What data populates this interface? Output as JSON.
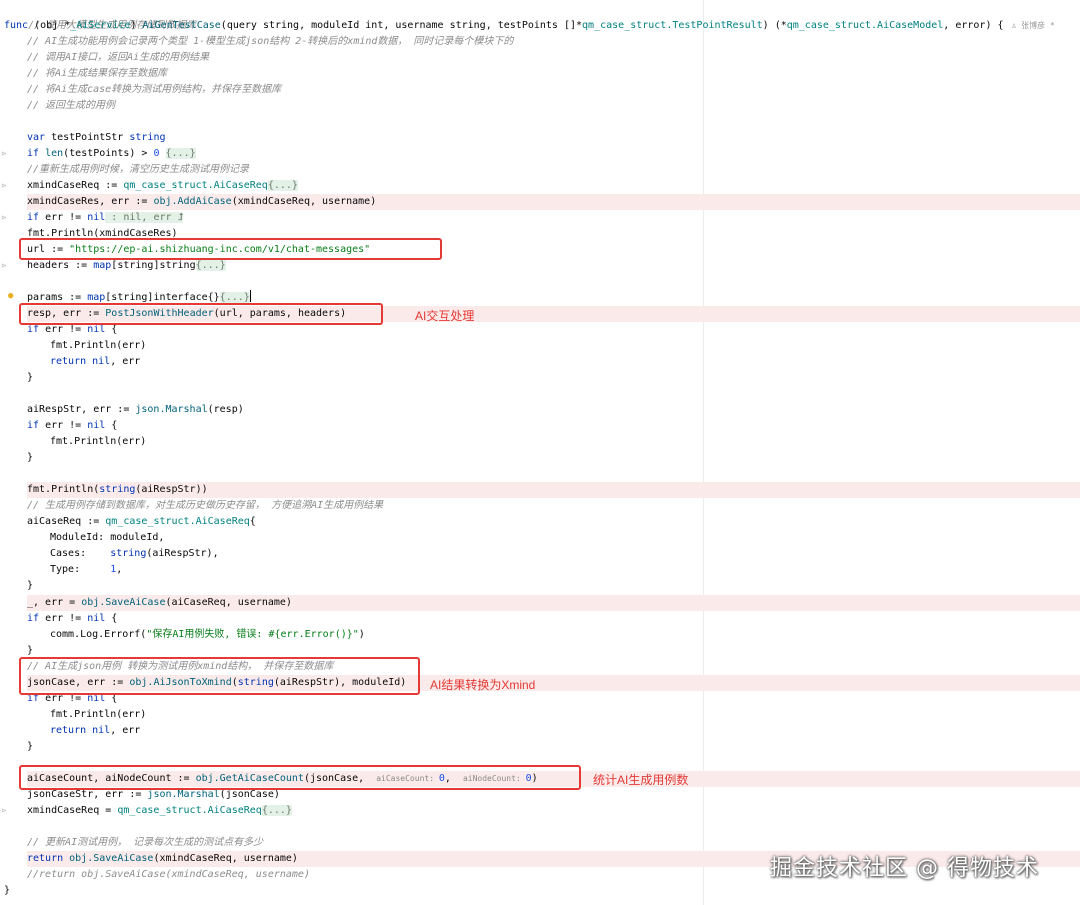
{
  "header_comment": "// 使用大模型生成用例存储到数据库",
  "func_sig": {
    "kw": "func",
    "recv_open": " (obj *",
    "recv_type": "_AiService",
    "recv_close": ") ",
    "name": "AiGenTestCase",
    "params_a": "(query string, moduleId int, username string, testPoints []*",
    "type1": "qm_case_struct.TestPointResult",
    "mid": ") (*",
    "type2": "qm_case_struct.AiCaseModel",
    "tail": ", error) {",
    "author": "♙ 张博彦 *"
  },
  "doc_comments": [
    "// AI生成功能用例会记录两个类型 1-模型生成json结构 2-转换后的xmind数据， 同时记录每个模块下的",
    "// 调用AI接口，返回Ai生成的用例结果",
    "// 将Ai生成结果保存至数据库",
    "// 将Ai生成case转换为测试用例结构，并保存至数据库",
    "// 返回生成的用例"
  ],
  "var_line": {
    "kw": "var",
    "rest": " testPointStr ",
    "type": "string"
  },
  "if_len": {
    "kw": "if",
    "fn": " len",
    "rest": "(testPoints) > ",
    "num": "0",
    "fold": "{...}"
  },
  "reset_comment": "//重新生成用例时候，清空历史生成测试用例记录",
  "xmind_req": {
    "lhs": "xmindCaseReq := ",
    "type": "qm_case_struct.AiCaseReq",
    "fold": "{...}"
  },
  "add_case": {
    "lhs": "xmindCaseRes, err := ",
    "obj": "obj",
    "method": ".AddAiCase",
    "args": "(xmindCaseReq, username)"
  },
  "if_err_fold": {
    "kw": "if",
    "rest": " err != ",
    "nil": "nil",
    "fold": " : nil, err ⮥"
  },
  "println_res": "fmt.Println(xmindCaseRes)",
  "url_line": {
    "lhs": "url := ",
    "value": "\"https://ep-ai.shizhuang-inc.com/v1/chat-messages\""
  },
  "headers_line": {
    "lhs": "headers := ",
    "kw": "map",
    "rest": "[string]string",
    "fold": "{...}"
  },
  "params_line": {
    "lhs": "params := ",
    "kw": "map",
    "rest": "[string]interface{}",
    "fold": "{...}"
  },
  "resp_line": {
    "lhs": "resp, err := ",
    "fn": "PostJsonWithHeader",
    "args": "(url, params, headers)"
  },
  "if_err": {
    "kw": "if",
    "rest": " err != ",
    "nil": "nil",
    "brace": " {"
  },
  "println_err": "fmt.Println(err)",
  "return_nil_err": {
    "kw": "return",
    "nil": " nil",
    "rest": ", err"
  },
  "close_brace": "}",
  "marshal_line": {
    "lhs": "aiRespStr, err := ",
    "fn": "json.Marshal",
    "args": "(resp)"
  },
  "println_string": {
    "pre": "fmt.Println(",
    "kw": "string",
    "args": "(aiRespStr))"
  },
  "store_comment": "// 生成用例存储到数据库，对生成历史做历史存留， 方便追溯AI生成用例结果",
  "aicase_req": {
    "lhs": "aiCaseReq := ",
    "type": "qm_case_struct.AiCaseReq",
    "brace": "{"
  },
  "field_module": "ModuleId: moduleId,",
  "field_cases": {
    "key": "Cases:    ",
    "kw": "string",
    "rest": "(aiRespStr),"
  },
  "field_type": {
    "key": "Type:     ",
    "num": "1",
    "rest": ","
  },
  "save_line": {
    "lhs": "_, err = ",
    "obj": "obj",
    "method": ".SaveAiCase",
    "args": "(aiCaseReq, username)"
  },
  "errorf_line": {
    "pre": "comm.Log.Errorf(",
    "str": "\"保存AI用例失败, 错误: #{err.Error()}\"",
    "post": ")"
  },
  "json_comment": "// AI生成json用例 转换为测试用例xmind结构， 并保存至数据库",
  "xmind_line": {
    "lhs": "jsonCase, err := ",
    "obj": "obj",
    "method": ".AiJsonToXmind",
    "open": "(",
    "kw": "string",
    "args": "(aiRespStr), moduleId)"
  },
  "count_line": {
    "lhs": "aiCaseCount, aiNodeCount := ",
    "obj": "obj",
    "method": ".GetAiCaseCount",
    "args": "(jsonCase,",
    "hint1": "aiCaseCount: ",
    "hint1_val": "0",
    "hint2": "aiNodeCount: ",
    "hint2_val": "0",
    "close": ")"
  },
  "json_str_line": {
    "lhs": "jsonCaseStr, err := ",
    "fn": "json.Marshal",
    "args": "(jsonCase)"
  },
  "xmind_req2": {
    "lhs": "xmindCaseReq = ",
    "type": "qm_case_struct.AiCaseReq",
    "fold": "{...}"
  },
  "update_comment": "// 更新AI测试用例， 记录每次生成的测试点有多少",
  "return_save": {
    "kw": "return",
    "obj": " obj",
    "method": ".SaveAiCase",
    "args": "(xmindCaseReq, username)"
  },
  "return_comment": "//return obj.SaveAiCase(xmindCaseReq, username)",
  "annotations": {
    "ai_interaction": "AI交互处理",
    "ai_to_xmind": "AI结果转换为Xmind",
    "count_cases": "统计AI生成用例数"
  },
  "watermark": "掘金技术社区 @ 得物技术"
}
